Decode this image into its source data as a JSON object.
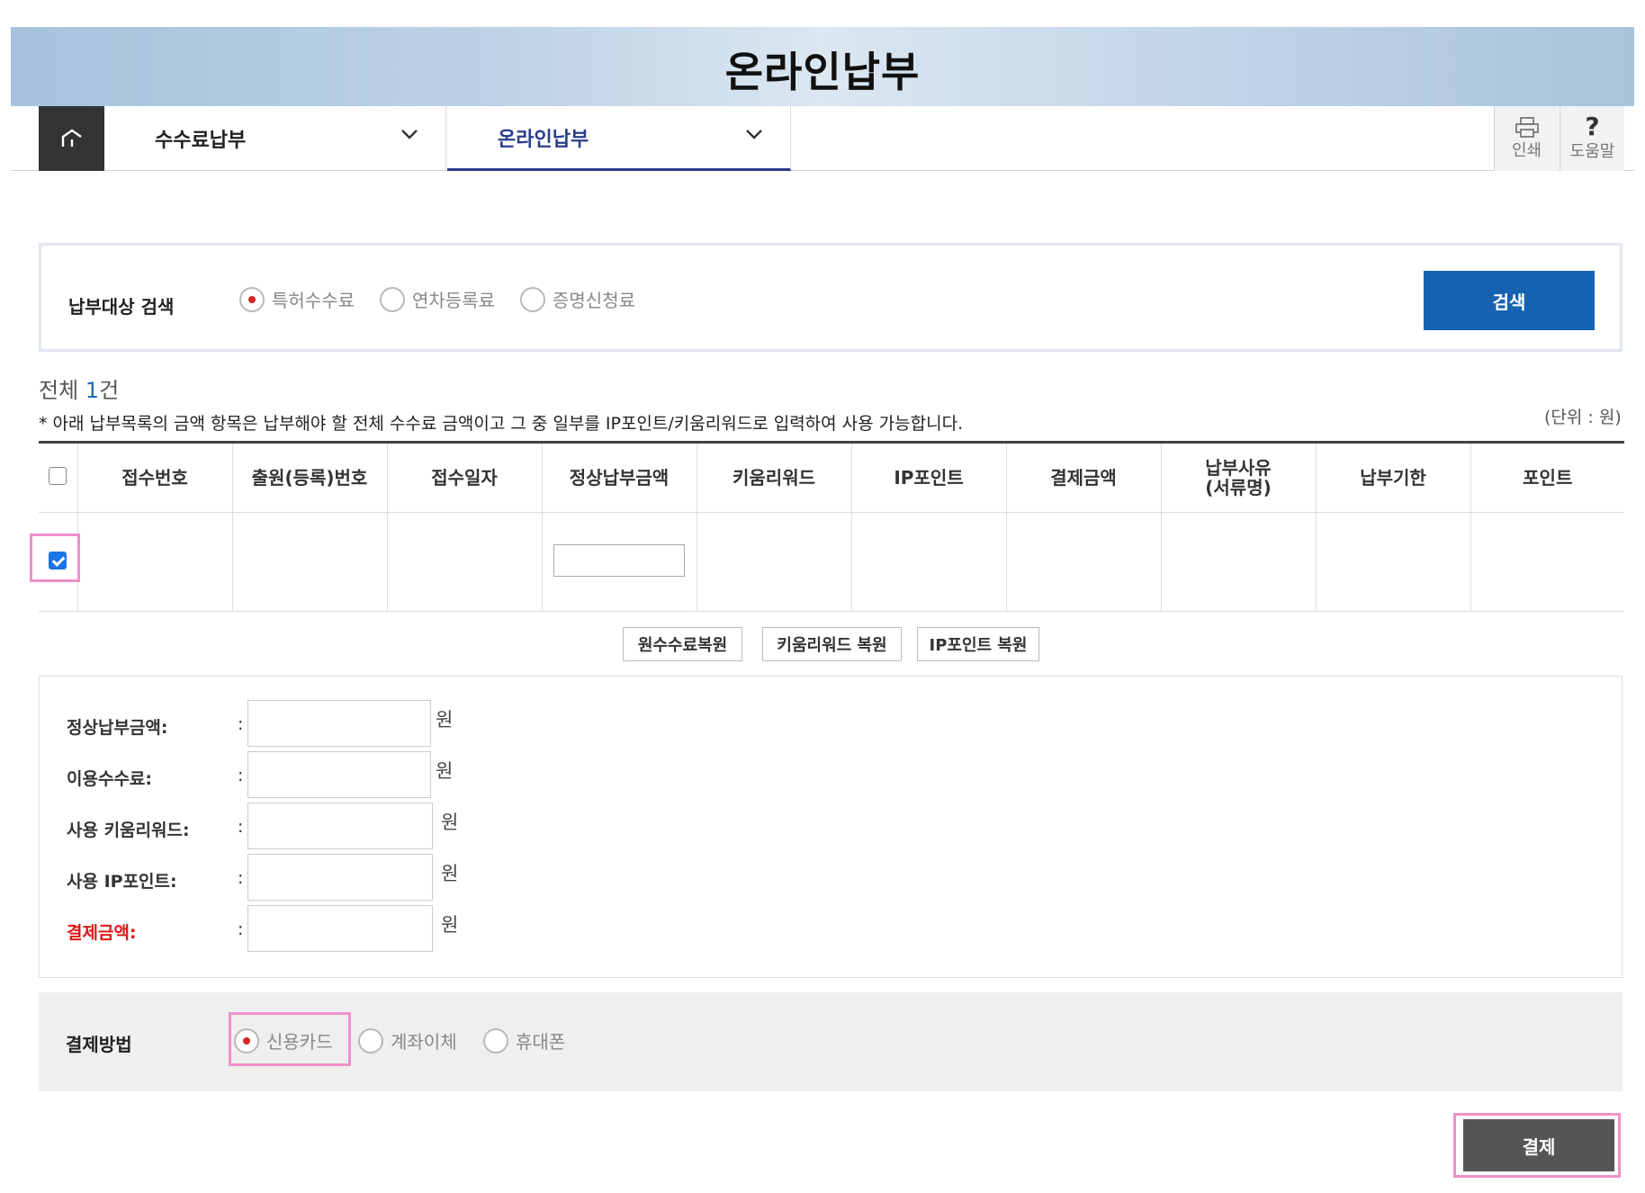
{
  "header": {
    "title": "온라인납부"
  },
  "nav": {
    "menu1": "수수료납부",
    "menu2": "온라인납부",
    "print_label": "인쇄",
    "help_label": "도움말",
    "help_symbol": "?"
  },
  "search": {
    "label": "납부대상 검색",
    "options": [
      "특허수수료",
      "연차등록료",
      "증명신청료"
    ],
    "selected": "특허수수료",
    "button": "검색"
  },
  "result": {
    "total_prefix": "전체 ",
    "total_count": "1",
    "total_suffix": "건",
    "notice": "* 아래 납부목록의 금액 항목은 납부해야 할 전체 수수료 금액이고 그 중 일부를 IP포인트/키움리워드로 입력하여 사용 가능합니다.",
    "unit": "(단위 : 원)"
  },
  "table": {
    "headers": [
      "접수번호",
      "출원(등록)번호",
      "접수일자",
      "정상납부금액",
      "키움리워드",
      "IP포인트",
      "결제금액",
      "납부사유",
      "(서류명)",
      "납부기한",
      "포인트"
    ],
    "row_checked": true
  },
  "restore_buttons": [
    "원수수료복원",
    "키움리워드 복원",
    "IP포인트 복원"
  ],
  "summary": {
    "rows": [
      {
        "label": "정상납부금액:",
        "colon": ":",
        "unit": "원"
      },
      {
        "label": "이용수수료:",
        "colon": ":",
        "unit": "원"
      },
      {
        "label": "사용 키움리워드:",
        "colon": ":",
        "unit": "원"
      },
      {
        "label": "사용 IP포인트:",
        "colon": ":",
        "unit": "원"
      },
      {
        "label": "결제금액:",
        "colon": ":",
        "unit": "원"
      }
    ]
  },
  "payment": {
    "label": "결제방법",
    "options": [
      "신용카드",
      "계좌이체",
      "휴대폰"
    ],
    "selected": "신용카드",
    "submit": "결제"
  },
  "colors": {
    "accent_blue": "#1763b1",
    "nav_active": "#2b3d8f",
    "highlight": "#ee90c8",
    "required_red": "#e01515"
  }
}
